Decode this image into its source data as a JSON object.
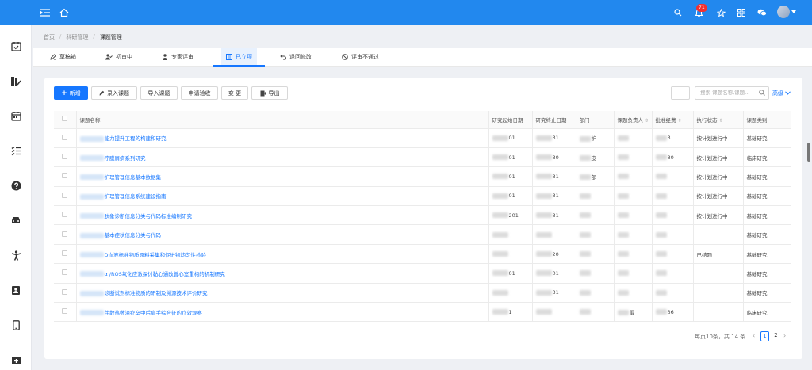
{
  "topbar": {
    "notification_count": "71"
  },
  "breadcrumb": [
    "首页",
    "科研管理",
    "课题管理"
  ],
  "tabs": [
    {
      "label": "草稿箱",
      "icon": "edit-icon"
    },
    {
      "label": "初审中",
      "icon": "user-check-icon"
    },
    {
      "label": "专家评审",
      "icon": "expert-icon"
    },
    {
      "label": "已立项",
      "icon": "list-icon"
    },
    {
      "label": "退回修改",
      "icon": "return-icon"
    },
    {
      "label": "评审不通过",
      "icon": "ban-icon"
    }
  ],
  "toolbar": {
    "add_label": "新增",
    "enter_label": "录入课题",
    "import_label": "导入课题",
    "apply_label": "申请验收",
    "change_label": "变 更",
    "export_label": "导出",
    "more_label": "···",
    "search_placeholder": "搜索 课题名称,课题...",
    "advanced_label": "高级"
  },
  "table": {
    "columns": [
      "课题名称",
      "研究起始日期",
      "研究终止日期",
      "部门",
      "课题负责人",
      "批准经费",
      "执行状态",
      "课题类别"
    ],
    "rows": [
      {
        "name": "能力提升工程的构建和研究",
        "start": "01",
        "end": "31",
        "dept": "护",
        "owner": "",
        "fund": "3",
        "status": "按计划进行中",
        "cat": "基础研究"
      },
      {
        "name": "疗膜屑病系列研究",
        "start": "01",
        "end": "30",
        "dept": "皮",
        "owner": "",
        "fund": "80",
        "status": "按计划进行中",
        "cat": "临床研究"
      },
      {
        "name": "护理管理信息基本数据集",
        "start": "01",
        "end": "31",
        "dept": "部",
        "owner": "",
        "fund": "",
        "status": "按计划进行中",
        "cat": "基础研究"
      },
      {
        "name": "护理管理信息系统建设指南",
        "start": "01",
        "end": "31",
        "dept": "",
        "owner": "",
        "fund": "",
        "status": "按计划进行中",
        "cat": "基础研究"
      },
      {
        "name": "肤象诊断信息分类与代码标准编制研究",
        "start": "201",
        "end": "31",
        "dept": "",
        "owner": "",
        "fund": "",
        "status": "按计划进行中",
        "cat": "基础研究"
      },
      {
        "name": "基本症状信息分类与代码",
        "start": "",
        "end": "",
        "dept": "",
        "owner": "",
        "fund": "",
        "status": "",
        "cat": "基础研究"
      },
      {
        "name": "D血液标准物质原料采集和促进物均匀性检验",
        "start": "",
        "end": "20",
        "dept": "",
        "owner": "",
        "fund": "",
        "status": "已结题",
        "cat": "基础研究"
      },
      {
        "name": "α /ROS氧化应激探讨黏心通改善心室重构的机制研究",
        "start": "01",
        "end": "01",
        "dept": "",
        "owner": "",
        "fund": "",
        "status": "",
        "cat": "基础研究"
      },
      {
        "name": "诊断试剂标准物质的研制及溯源技术评价研究",
        "start": "",
        "end": "31",
        "dept": "",
        "owner": "",
        "fund": "",
        "status": "",
        "cat": "基础研究"
      },
      {
        "name": "芪散热敷治疗卒中后肩手综合征的疗效观察",
        "start": "1",
        "end": "",
        "dept": "",
        "owner": "雷",
        "fund": "36",
        "status": "",
        "cat": "临床研究"
      }
    ]
  },
  "pagination": {
    "summary": "每页10条，共 14 条",
    "pages": [
      "1",
      "2"
    ],
    "current": "1"
  }
}
